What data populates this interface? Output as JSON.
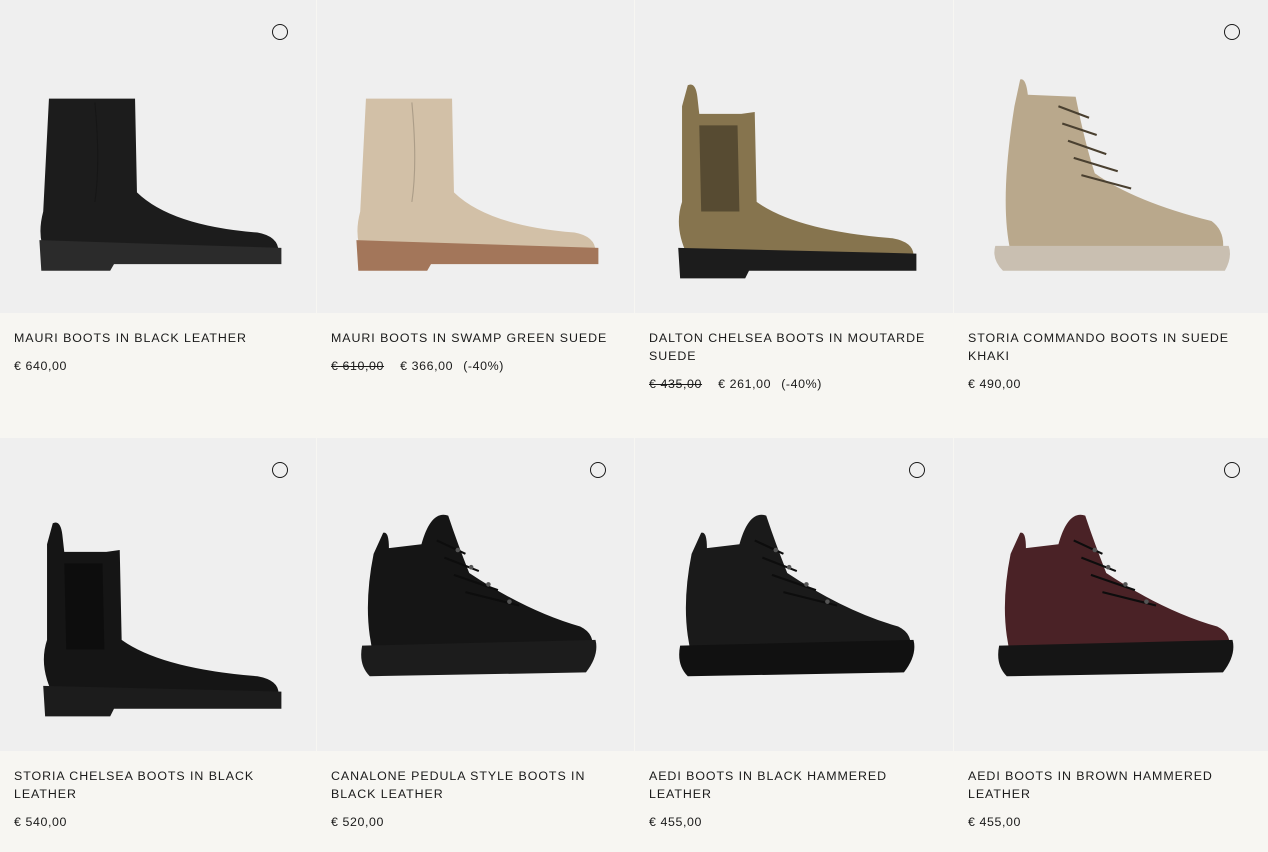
{
  "products": [
    {
      "name": "MAURI BOOTS IN BLACK LEATHER",
      "price": "€ 640,00",
      "old_price": "",
      "discount": "",
      "icon": "black-leather-boot-icon",
      "color": "#1c1c1c",
      "sole": "#2b2b2b"
    },
    {
      "name": "MAURI BOOTS IN SWAMP GREEN SUEDE",
      "price": "€ 366,00",
      "old_price": "€ 610,00",
      "discount": "(-40%)",
      "icon": "beige-suede-boot-icon",
      "color": "#d2c0a7",
      "sole": "#a3765a"
    },
    {
      "name": "DALTON CHELSEA BOOTS IN MOUTARDE SUEDE",
      "price": "€ 261,00",
      "old_price": "€ 435,00",
      "discount": "(-40%)",
      "icon": "chelsea-boot-icon",
      "color": "#86744e",
      "sole": "#1c1c1c"
    },
    {
      "name": "STORIA COMMANDO BOOTS IN SUEDE KHAKI",
      "price": "€ 490,00",
      "old_price": "",
      "discount": "",
      "icon": "lace-up-boot-icon",
      "color": "#b9a88c",
      "sole": "#c9bfb1"
    },
    {
      "name": "STORIA CHELSEA BOOTS IN BLACK LEATHER",
      "price": "€ 540,00",
      "old_price": "",
      "discount": "",
      "icon": "chelsea-boot-icon",
      "color": "#151515",
      "sole": "#1c1c1c"
    },
    {
      "name": "CANALONE PEDULA STYLE BOOTS IN BLACK LEATHER",
      "price": "€ 520,00",
      "old_price": "",
      "discount": "",
      "icon": "hiking-boot-icon",
      "color": "#151515",
      "sole": "#1c1c1c"
    },
    {
      "name": "AEDI BOOTS IN BLACK HAMMERED LEATHER",
      "price": "€ 455,00",
      "old_price": "",
      "discount": "",
      "icon": "hiking-boot-icon",
      "color": "#1a1a1a",
      "sole": "#111111"
    },
    {
      "name": "AEDI BOOTS IN BROWN HAMMERED LEATHER",
      "price": "€ 455,00",
      "old_price": "",
      "discount": "",
      "icon": "hiking-boot-icon",
      "color": "#4a2226",
      "sole": "#151515"
    }
  ]
}
